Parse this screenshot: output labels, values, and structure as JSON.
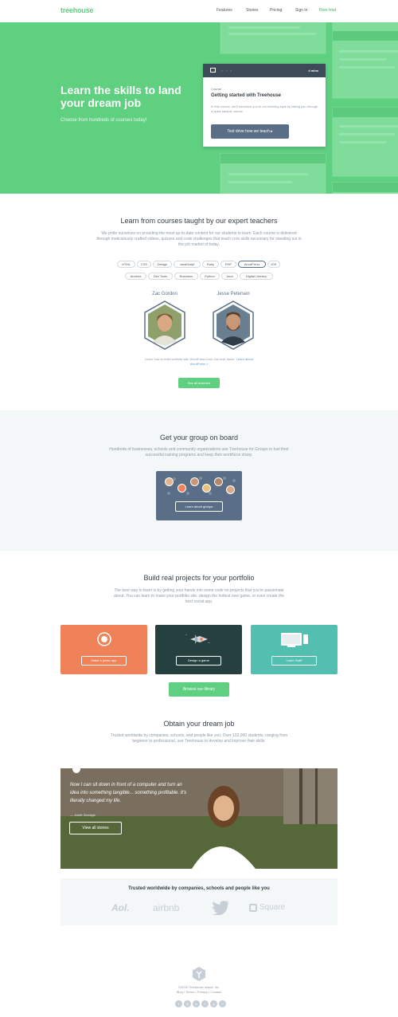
{
  "nav": {
    "logo": "treehouse",
    "links": [
      "Features",
      "Stories",
      "Pricing",
      "Sign in"
    ],
    "cta": "Free trial"
  },
  "hero": {
    "title": "Learn the skills to land your dream job",
    "subtitle": "Choose from hundreds of courses today!",
    "card": {
      "duration": "4 mins",
      "kicker": "Course",
      "title": "Getting started with Treehouse",
      "description": "In this course, we'll introduce you to our learning style by taking you through a quick sample course.",
      "button": "Test drive how we teach ▸"
    }
  },
  "teachers": {
    "title": "Learn from courses taught by our expert teachers",
    "text": "We pride ourselves on providing the most up-to-date content for our students to learn. Each course is delivered through meticulously crafted videos, quizzes and code challenges that teach core skills necessary for standing out in the job market of today.",
    "tags_row1": [
      "HTML",
      "CSS",
      "Design",
      "JavaScript",
      "Ruby",
      "PHP",
      "WordPress",
      "iOS"
    ],
    "tags_row2": [
      "Android",
      "Dev Tools",
      "Business",
      "Python",
      "Java",
      "Digital Literacy"
    ],
    "active_tag": "WordPress",
    "teacher1": "Zac Gordon",
    "teacher2": "Jesse Petersen",
    "caption": "Learn how to build website with WordPress from Zac and Jesse.",
    "caption_link": "Learn about WordPress »",
    "button": "See all teachers"
  },
  "groups": {
    "title": "Get your group on board",
    "text": "Hundreds of businesses, schools and community organizations use Treehouse for Groups to fuel their successful training programs and keep their workforce sharp.",
    "button": "Learn about groups"
  },
  "projects": {
    "title": "Build real projects for your portfolio",
    "text": "The best way to learn is by getting your hands into some code on projects that you're passionate about. You can learn to make your portfolio site, design the hottest new game, or even create the next social app.",
    "cards": [
      {
        "label": "Make a photo app",
        "color": "#f08259"
      },
      {
        "label": "Design a game",
        "color": "#25403f"
      },
      {
        "label": "Learn Swift",
        "color": "#53bfb0"
      }
    ],
    "button": "Browse our library"
  },
  "job": {
    "title": "Obtain your dream job",
    "text": "Trusted worldwide by companies, schools, and people like you. Over 132,000 students, ranging from beginner to professional, use Treehouse to develop and improve their skills.",
    "quote": "Now I can sit down in front of a computer and turn an idea into something tangible... something profitable. It's literally changed my life.",
    "author": "— Joelle Steiniger",
    "button": "View all stories"
  },
  "trusted": {
    "title": "Trusted worldwide by companies, schools and people like you",
    "brands": [
      "Aol.",
      "airbnb",
      "Square"
    ]
  },
  "footer": {
    "copyright": "©2015 Treehouse Island, Inc.",
    "links": "Blog • Terms • Privacy • Contact"
  },
  "colors": {
    "brand_green": "#5fcf80",
    "slate": "#5a6f87",
    "dark": "#384047"
  }
}
